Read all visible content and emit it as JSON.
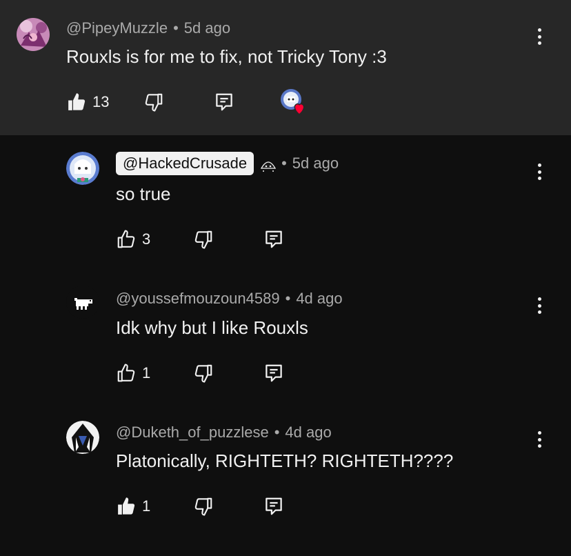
{
  "comments": [
    {
      "author": "@PipeyMuzzle",
      "time": "5d ago",
      "text": "Rouxls is for me to fix, not Tricky Tony :3",
      "likes": "13",
      "liked": true
    },
    {
      "author": "@HackedCrusade",
      "time": "5d ago",
      "text": "so true",
      "likes": "3",
      "liked": false
    },
    {
      "author": "@youssefmouzoun4589",
      "time": "4d ago",
      "text": "Idk why but I like Rouxls",
      "likes": "1",
      "liked": false
    },
    {
      "author": "@Duketh_of_puzzlese",
      "time": "4d ago",
      "text": "Platonically, RIGHTETH? RIGHTETH????",
      "likes": "1",
      "liked": true
    }
  ],
  "separator": "•",
  "colors": {
    "background": "#0f0f0f",
    "highlight_background": "#272727",
    "text_primary": "#f1f1f1",
    "text_secondary": "#aaaaaa",
    "heart": "#ff0033"
  }
}
